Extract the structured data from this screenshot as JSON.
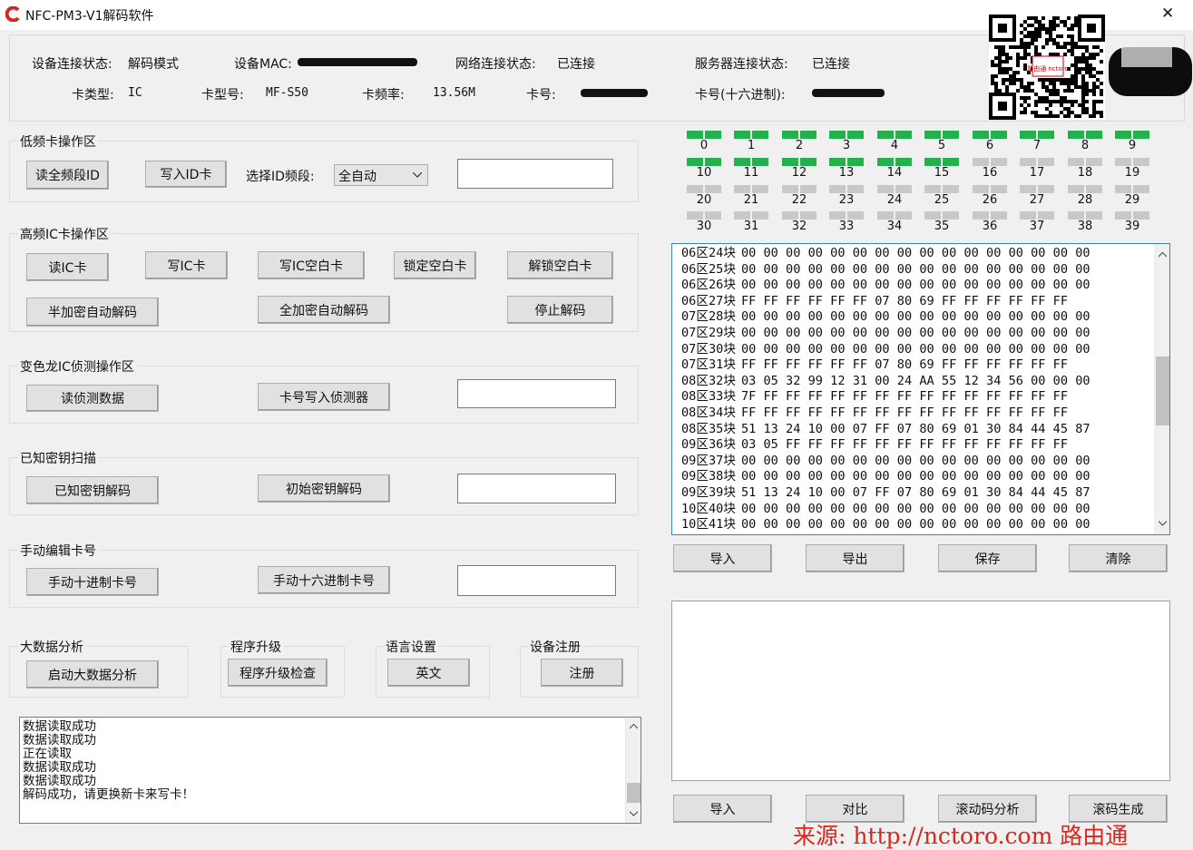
{
  "window": {
    "title": "NFC-PM3-V1解码软件",
    "close_icon": "✕"
  },
  "status": {
    "device_conn_label": "设备连接状态:",
    "device_conn_value": "解码模式",
    "mac_label": "设备MAC:",
    "net_conn_label": "网络连接状态:",
    "net_conn_value": "已连接",
    "server_conn_label": "服务器连接状态:",
    "server_conn_value": "已连接",
    "card_type_label": "卡类型:",
    "card_type_value": "IC",
    "card_model_label": "卡型号:",
    "card_model_value": "MF-S50",
    "freq_label": "卡频率:",
    "freq_value": "13.56M",
    "card_no_label": "卡号:",
    "card_hex_label": "卡号(十六进制):"
  },
  "lf": {
    "title": "低频卡操作区",
    "read_all": "读全频段ID",
    "write_id": "写入ID卡",
    "select_label": "选择ID频段:",
    "select_value": "全自动"
  },
  "hf": {
    "title": "高频IC卡操作区",
    "read_ic": "读IC卡",
    "write_ic": "写IC卡",
    "write_blank": "写IC空白卡",
    "lock_blank": "锁定空白卡",
    "unlock_blank": "解锁空白卡",
    "half_decode": "半加密自动解码",
    "full_decode": "全加密自动解码",
    "stop_decode": "停止解码"
  },
  "chameleon": {
    "title": "变色龙IC侦测操作区",
    "read_detect": "读侦测数据",
    "write_detect": "卡号写入侦测器"
  },
  "known": {
    "title": "已知密钥扫描",
    "known_decode": "已知密钥解码",
    "init_decode": "初始密钥解码"
  },
  "manual": {
    "title": "手动编辑卡号",
    "dec": "手动十进制卡号",
    "hex": "手动十六进制卡号"
  },
  "bigdata": {
    "title": "大数据分析",
    "start": "启动大数据分析"
  },
  "upgrade": {
    "title": "程序升级",
    "check": "程序升级检查"
  },
  "lang": {
    "title": "语言设置",
    "english": "英文"
  },
  "register": {
    "title": "设备注册",
    "register": "注册"
  },
  "log": [
    "数据读取成功",
    "数据读取成功",
    "正在读取",
    "数据读取成功",
    "数据读取成功",
    "解码成功，请更换新卡来写卡！"
  ],
  "sectors": {
    "labels": [
      "0",
      "1",
      "2",
      "3",
      "4",
      "5",
      "6",
      "7",
      "8",
      "9",
      "10",
      "11",
      "12",
      "13",
      "14",
      "15",
      "16",
      "17",
      "18",
      "19",
      "20",
      "21",
      "22",
      "23",
      "24",
      "25",
      "26",
      "27",
      "28",
      "29",
      "30",
      "31",
      "32",
      "33",
      "34",
      "35",
      "36",
      "37",
      "38",
      "39"
    ],
    "status": [
      "ok",
      "ok",
      "ok",
      "ok",
      "ok",
      "ok",
      "ok",
      "ok",
      "ok",
      "ok",
      "ok",
      "ok",
      "ok",
      "ok",
      "ok",
      "ok",
      "none",
      "none",
      "none",
      "none",
      "none",
      "none",
      "none",
      "none",
      "none",
      "none",
      "none",
      "none",
      "none",
      "none",
      "none",
      "none",
      "none",
      "none",
      "none",
      "none",
      "none",
      "none",
      "none",
      "none"
    ],
    "colors": {
      "ok": "#22b14c",
      "none": "#c8c8c8"
    }
  },
  "blocks": [
    {
      "label": "06区24块",
      "data": "00 00 00 00 00 00 00 00 00 00 00 00 00 00 00 00"
    },
    {
      "label": "06区25块",
      "data": "00 00 00 00 00 00 00 00 00 00 00 00 00 00 00 00"
    },
    {
      "label": "06区26块",
      "data": "00 00 00 00 00 00 00 00 00 00 00 00 00 00 00 00"
    },
    {
      "label": "06区27块",
      "data": "FF FF FF FF FF FF 07 80 69 FF FF FF FF FF FF"
    },
    {
      "label": "07区28块",
      "data": "00 00 00 00 00 00 00 00 00 00 00 00 00 00 00 00"
    },
    {
      "label": "07区29块",
      "data": "00 00 00 00 00 00 00 00 00 00 00 00 00 00 00 00"
    },
    {
      "label": "07区30块",
      "data": "00 00 00 00 00 00 00 00 00 00 00 00 00 00 00 00"
    },
    {
      "label": "07区31块",
      "data": "FF FF FF FF FF FF 07 80 69 FF FF FF FF FF FF"
    },
    {
      "label": "08区32块",
      "data": "03 05 32 99 12 31 00 24 AA 55 12 34 56 00 00 00"
    },
    {
      "label": "08区33块",
      "data": "7F FF FF FF FF FF FF FF FF FF FF FF FF FF FF"
    },
    {
      "label": "08区34块",
      "data": "FF FF FF FF FF FF FF FF FF FF FF FF FF FF FF"
    },
    {
      "label": "08区35块",
      "data": "51 13 24 10 00 07 FF 07 80 69 01 30 84 44 45 87"
    },
    {
      "label": "09区36块",
      "data": "03 05 FF FF FF FF FF FF FF FF FF FF FF FF FF"
    },
    {
      "label": "09区37块",
      "data": "00 00 00 00 00 00 00 00 00 00 00 00 00 00 00 00"
    },
    {
      "label": "09区38块",
      "data": "00 00 00 00 00 00 00 00 00 00 00 00 00 00 00 00"
    },
    {
      "label": "09区39块",
      "data": "51 13 24 10 00 07 FF 07 80 69 01 30 84 44 45 87"
    },
    {
      "label": "10区40块",
      "data": "00 00 00 00 00 00 00 00 00 00 00 00 00 00 00 00"
    },
    {
      "label": "10区41块",
      "data": "00 00 00 00 00 00 00 00 00 00 00 00 00 00 00 00"
    }
  ],
  "data_buttons": {
    "import": "导入",
    "export": "导出",
    "save": "保存",
    "clear": "清除"
  },
  "bottom_buttons": {
    "import": "导入",
    "compare": "对比",
    "rolling_analysis": "滚动码分析",
    "rolling_generate": "滚码生成"
  },
  "watermark": "来源: http://nctoro.com 路由通",
  "qr_caption": "路由通 nctoro"
}
